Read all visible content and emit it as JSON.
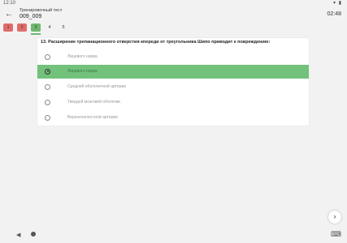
{
  "status_bar": {
    "time": "12:10",
    "icons": "▾ ▮"
  },
  "appbar": {
    "back_icon": "←",
    "subtitle": "Тренировочный тест",
    "title": "009_009",
    "timer": "02:48"
  },
  "question_nav": {
    "items": [
      {
        "label": "1",
        "state": "wrong"
      },
      {
        "label": "2",
        "state": "wrong"
      },
      {
        "label": "3",
        "state": "correct"
      },
      {
        "label": "4",
        "state": "unanswered"
      },
      {
        "label": "5",
        "state": "unanswered"
      }
    ],
    "active_index": 2,
    "colors": {
      "wrong": "#e06b6b",
      "correct": "#6fb86f"
    }
  },
  "question": {
    "text": "13. Расширение трепанационного отверстия кпереди от треугольника Шипо приводит к повреждению:",
    "options": [
      {
        "label": "Лицевого нерва",
        "selected": false
      },
      {
        "label": "Лицевого нерва",
        "selected": true
      },
      {
        "label": "Средней оболочечной артерии",
        "selected": false
      },
      {
        "label": "Твердой мозговой оболочки",
        "selected": false
      },
      {
        "label": "Верхнечелюстной артерии",
        "selected": false
      }
    ],
    "selected_color": "#72c27b"
  },
  "fab": {
    "icon": "›"
  },
  "nav_bar": {
    "back": "◀",
    "keyboard": "⌨"
  }
}
